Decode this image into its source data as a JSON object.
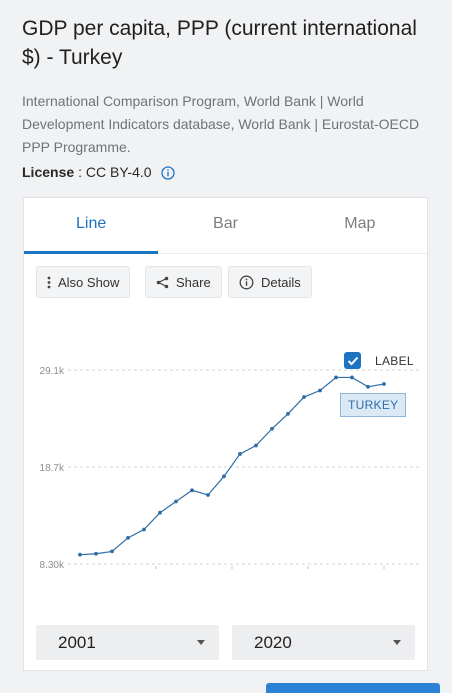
{
  "title": "GDP per capita, PPP (current international $) - Turkey",
  "source": "International Comparison Program, World Bank | World Development Indicators database, World Bank | Eurostat-OECD PPP Programme.",
  "license": {
    "label": "License",
    "value": ": CC BY-4.0"
  },
  "tabs": [
    {
      "label": "Line"
    },
    {
      "label": "Bar"
    },
    {
      "label": "Map"
    }
  ],
  "buttons": {
    "also_show": "Also Show",
    "share": "Share",
    "details": "Details"
  },
  "label_toggle": {
    "text": "LABEL",
    "checked": true
  },
  "series_tag": "TURKEY",
  "range": {
    "start": "2001",
    "end": "2020"
  },
  "chart_data": {
    "type": "line",
    "yticks": [
      "29.1k",
      "18.7k",
      "8.30k"
    ],
    "ylim": [
      8300,
      29100
    ],
    "x": [
      2001,
      2002,
      2003,
      2004,
      2005,
      2006,
      2007,
      2008,
      2009,
      2010,
      2011,
      2012,
      2013,
      2014,
      2015,
      2016,
      2017,
      2018,
      2019,
      2020
    ],
    "series": [
      {
        "name": "TURKEY",
        "values": [
          9300,
          9400,
          9650,
          11100,
          12000,
          13800,
          15000,
          16200,
          15700,
          17700,
          20100,
          21000,
          22800,
          24400,
          26200,
          26900,
          28300,
          28300,
          27300,
          27600
        ]
      }
    ],
    "series_color": "#2f6ea6",
    "grid": true
  }
}
